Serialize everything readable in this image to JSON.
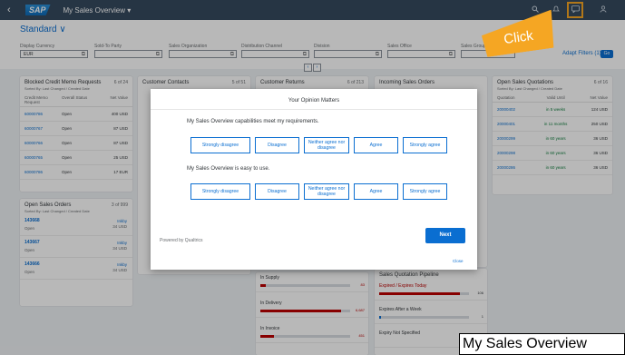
{
  "shell": {
    "back_glyph": "‹",
    "logo": "SAP",
    "title": "My Sales Overview ▾",
    "icons": [
      "search-icon",
      "notifications-icon",
      "feedback-icon",
      "user-icon"
    ]
  },
  "header": {
    "variant": "Standard ∨",
    "filters": [
      {
        "label": "Display Currency",
        "value": "EUR"
      },
      {
        "label": "Sold-To Party",
        "value": ""
      },
      {
        "label": "Sales Organization",
        "value": ""
      },
      {
        "label": "Distribution Channel",
        "value": ""
      },
      {
        "label": "Division",
        "value": ""
      },
      {
        "label": "Sales Office",
        "value": ""
      },
      {
        "label": "Sales Group",
        "value": ""
      }
    ],
    "adapt_filters": "Adapt Filters (1)",
    "go": "Go"
  },
  "cards": {
    "blocked": {
      "title": "Blocked Credit Memo Requests",
      "count": "6 of 24",
      "sub": "Sorted By: Last Changed / Created Date",
      "columns": [
        "Credit Memo Request",
        "Overall Status",
        "Net Value"
      ],
      "rows": [
        [
          "60000786",
          "Open",
          "400 USD"
        ],
        [
          "60000767",
          "Open",
          "87 USD"
        ],
        [
          "60000766",
          "Open",
          "87 USD"
        ],
        [
          "60000765",
          "Open",
          "25 USD"
        ],
        [
          "60000786",
          "Open",
          "17 EUR"
        ]
      ]
    },
    "open_orders": {
      "title": "Open Sales Orders",
      "count": "3 of 999",
      "sub": "Sorted By: Last Changed / Created Date",
      "items": [
        {
          "num": "143668",
          "status": "Open",
          "name": "Inkby",
          "amount": "34 USD"
        },
        {
          "num": "143667",
          "status": "Open",
          "name": "Inkby",
          "amount": "34 USD"
        },
        {
          "num": "143666",
          "status": "Open",
          "name": "Inkby",
          "amount": "34 USD"
        }
      ]
    },
    "contacts": {
      "title": "Customer Contacts",
      "count": "5 of 51"
    },
    "returns": {
      "title": "Customer Returns",
      "count": "6 of 213"
    },
    "incoming": {
      "title": "Incoming Sales Orders"
    },
    "quotations": {
      "title": "Open Sales Quotations",
      "count": "6 of 16",
      "sub": "Sorted By: Last Changed / Created Date",
      "columns": [
        "Quotation",
        "Valid Until",
        "Net Value"
      ],
      "rows": [
        [
          "20000402",
          "in 5 weeks",
          "124 USD"
        ],
        [
          "20000401",
          "in 11 months",
          "250 USD"
        ],
        [
          "20000299",
          "in 60 years",
          "36 USD"
        ],
        [
          "20000298",
          "in 60 years",
          "36 USD"
        ],
        [
          "20000286",
          "in 60 years",
          "36 USD"
        ]
      ]
    },
    "supply": {
      "items": [
        {
          "label": "In Supply",
          "value": "83",
          "fill": 0.06
        },
        {
          "label": "In Delivery",
          "value": "6,687",
          "fill": 0.9
        },
        {
          "label": "In Invoice",
          "value": "451",
          "fill": 0.15
        }
      ]
    },
    "pipeline": {
      "title": "Sales Quotation Pipeline",
      "items": [
        {
          "label": "Expired / Expires Today",
          "value": "106",
          "fill": 0.9
        },
        {
          "label": "Expires After a Week",
          "value": "1",
          "fill": 0.02
        },
        {
          "label": "Expiry Not Specified",
          "value": "",
          "fill": 0.0
        }
      ]
    }
  },
  "dialog": {
    "title": "Your Opinion Matters",
    "q1": "My Sales Overview capabilities meet my requirements.",
    "q2": "My Sales Overview is easy to use.",
    "options": [
      "Strongly disagree",
      "Disagree",
      "Neither agree nor disagree",
      "Agree",
      "Strongly agree"
    ],
    "powered": "Powered by Qualtrics",
    "next": "Next",
    "close": "Close"
  },
  "callout": "Click",
  "caption": "My Sales Overview"
}
